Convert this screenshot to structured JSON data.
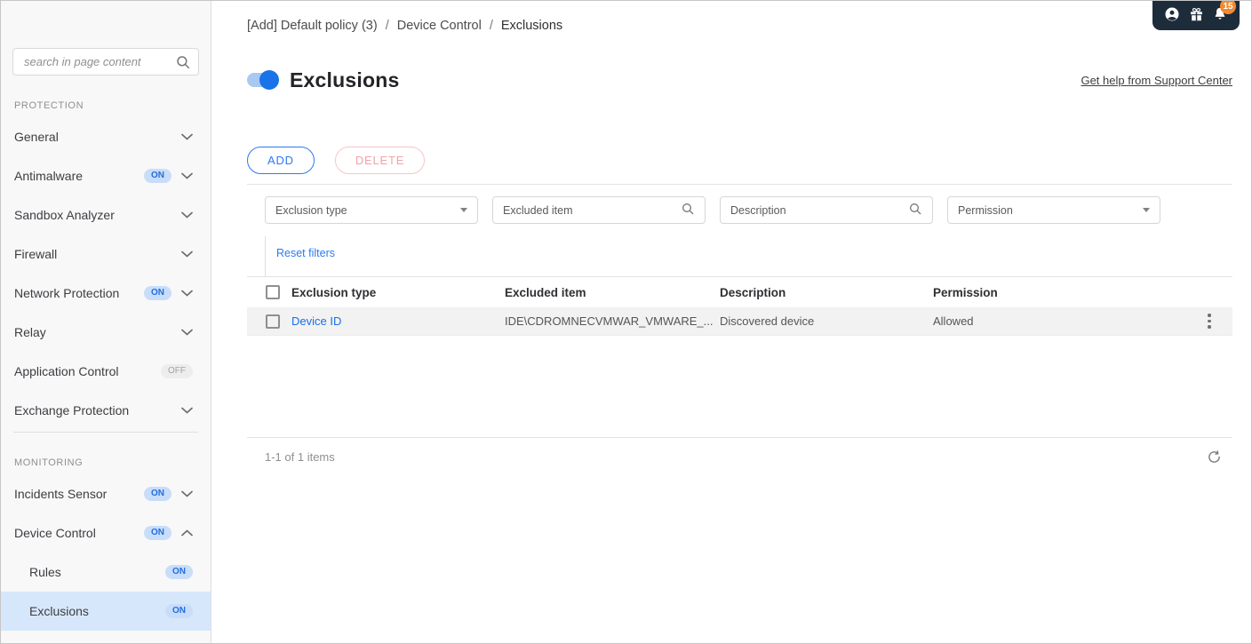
{
  "colors": {
    "accent": "#2d7af0",
    "topbar_bg": "#1d2c3b",
    "notification_badge": "#f18a33",
    "selected_bg": "#d7e7fb",
    "row_bg": "#f2f2f2",
    "sidebar_bg": "#f8f8f9",
    "border": "#e3e3e3",
    "badge_on_bg": "#c9ddf9",
    "badge_on_text": "#1f6fe0",
    "badge_off_bg": "#ededee",
    "badge_off_text": "#a2a2a6",
    "delete_border": "#f6c5c9",
    "delete_text": "#f2a3a9",
    "toggle_track": "#a9c9f3"
  },
  "topbar": {
    "notification_count": "15"
  },
  "sidebar": {
    "search_placeholder": "search in page content",
    "sections": [
      {
        "title": "PROTECTION",
        "items": [
          {
            "label": "General"
          },
          {
            "label": "Antimalware",
            "badge": "ON"
          },
          {
            "label": "Sandbox Analyzer"
          },
          {
            "label": "Firewall"
          },
          {
            "label": "Network Protection",
            "badge": "ON"
          },
          {
            "label": "Relay"
          },
          {
            "label": "Application Control",
            "badge": "OFF"
          },
          {
            "label": "Exchange Protection"
          }
        ]
      },
      {
        "title": "MONITORING",
        "items": [
          {
            "label": "Incidents Sensor",
            "badge": "ON"
          },
          {
            "label": "Device Control",
            "badge": "ON"
          },
          {
            "label": "Rules",
            "badge": "ON"
          },
          {
            "label": "Exclusions",
            "badge": "ON"
          }
        ]
      }
    ]
  },
  "page": {
    "breadcrumb": [
      "[Add] Default policy (3)",
      "Device Control",
      "Exclusions"
    ],
    "separator": "/",
    "title": "Exclusions",
    "toggle_state": "on",
    "help_link": "Get help from Support Center",
    "toolbar": {
      "add_label": "ADD",
      "delete_label": "DELETE"
    },
    "filters": {
      "exclusion_type": "Exclusion type",
      "excluded_item": "Excluded item",
      "description": "Description",
      "permission": "Permission",
      "reset_label": "Reset filters"
    },
    "table": {
      "columns": [
        "Exclusion type",
        "Excluded item",
        "Description",
        "Permission"
      ],
      "rows": [
        {
          "exclusion_type": "Device ID",
          "excluded_item": "IDE\\CDROMNECVMWAR_VMWARE_...",
          "description": "Discovered device",
          "permission": "Allowed"
        }
      ]
    },
    "footer": {
      "items_text": "1-1 of 1 items"
    }
  }
}
